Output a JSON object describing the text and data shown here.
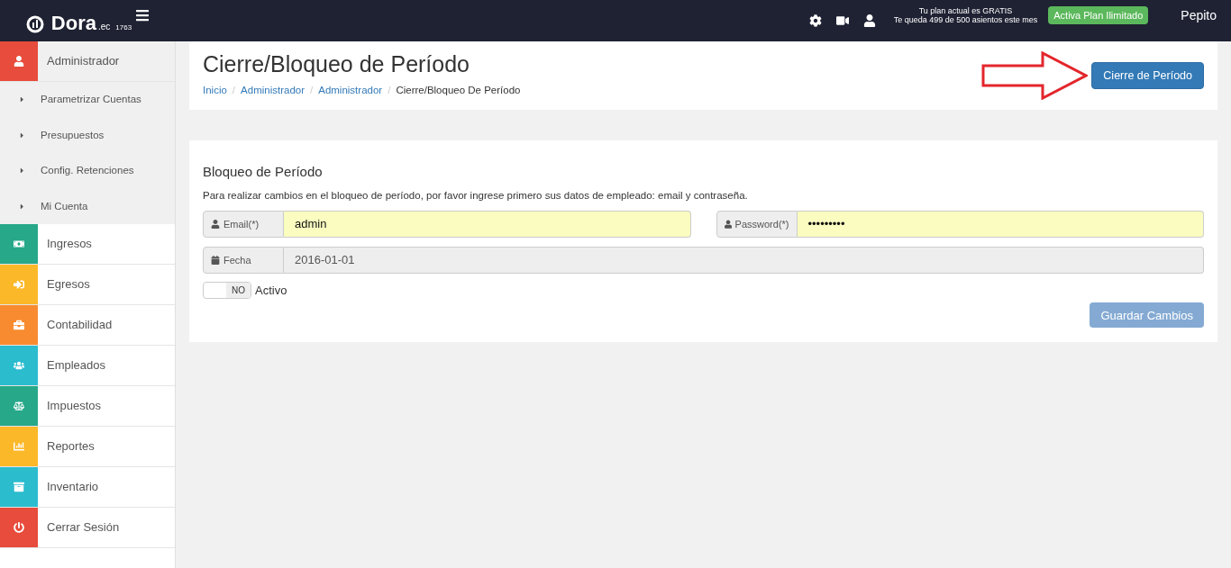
{
  "header": {
    "brand": "Dora",
    "brand_suffix": ".ec",
    "build": "1763",
    "plan_line_1": "Tu plan actual es GRATIS",
    "plan_line_2": "Te queda 499 de 500 asientos este mes",
    "upgrade_button": "Activa Plan Ilimitado",
    "user": "Pepito"
  },
  "sidebar": {
    "items": [
      {
        "label": "Administrador",
        "kind": "user",
        "color": "#e74c3c",
        "expanded": true,
        "children": [
          {
            "label": "Parametrizar Cuentas"
          },
          {
            "label": "Presupuestos"
          },
          {
            "label": "Config. Retenciones"
          },
          {
            "label": "Mi Cuenta"
          }
        ]
      },
      {
        "label": "Ingresos",
        "kind": "money",
        "color": "#26a889",
        "expanded": false
      },
      {
        "label": "Egresos",
        "kind": "signin",
        "color": "#fbb829",
        "expanded": false
      },
      {
        "label": "Contabilidad",
        "kind": "briefcase",
        "color": "#f88b2f",
        "expanded": false
      },
      {
        "label": "Empleados",
        "kind": "users",
        "color": "#2bbcce",
        "expanded": false
      },
      {
        "label": "Impuestos",
        "kind": "scale",
        "color": "#26a889",
        "expanded": false
      },
      {
        "label": "Reportes",
        "kind": "chart",
        "color": "#fbb829",
        "expanded": false
      },
      {
        "label": "Inventario",
        "kind": "box",
        "color": "#2bbcce",
        "expanded": false
      },
      {
        "label": "Cerrar Sesión",
        "kind": "power",
        "color": "#e74c3c",
        "expanded": false
      }
    ]
  },
  "page": {
    "title": "Cierre/Bloqueo de Período",
    "breadcrumb": [
      {
        "label": "Inicio",
        "link": true
      },
      {
        "separator": "/",
        "label": "Administrador",
        "link": true
      },
      {
        "separator": "/",
        "label": "Administrador",
        "link": true
      },
      {
        "separator": "/",
        "label": "Cierre/Bloqueo De Período",
        "link": false
      }
    ],
    "action_button": "Cierre de Período"
  },
  "form": {
    "title": "Bloqueo de Período",
    "intro": "Para realizar cambios en el bloqueo de período, por favor ingrese primero sus datos de empleado: email y contraseña.",
    "email": {
      "label": "Email(*)",
      "value": "admin"
    },
    "password": {
      "label": "Password(*)",
      "value": "•••••••••"
    },
    "date": {
      "label": "Fecha",
      "value": "2016-01-01"
    },
    "active": {
      "label": "Activo",
      "state_text": "NO",
      "on": false
    },
    "save_button": {
      "label": "Guardar Cambios",
      "disabled": true
    }
  }
}
